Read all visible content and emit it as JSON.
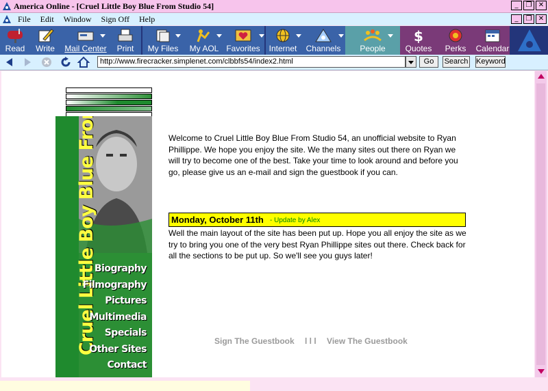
{
  "window": {
    "app_name": "America  Online",
    "title": "America  Online - [Cruel Little Boy Blue From Studio 54]"
  },
  "menu": [
    "File",
    "Edit",
    "Window",
    "Sign Off",
    "Help"
  ],
  "toolbar": {
    "buttons": [
      {
        "label": "Read",
        "icon": "mailbox-icon"
      },
      {
        "label": "Write",
        "icon": "pencil-icon"
      },
      {
        "label": "Mail Center",
        "icon": "mail-center-icon"
      },
      {
        "label": "Print",
        "icon": "printer-icon"
      },
      {
        "label": "My Files",
        "icon": "files-icon"
      },
      {
        "label": "My AOL",
        "icon": "my-aol-icon"
      },
      {
        "label": "Favorites",
        "icon": "heart-icon"
      },
      {
        "label": "Internet",
        "icon": "globe-icon"
      },
      {
        "label": "Channels",
        "icon": "channels-icon"
      },
      {
        "label": "People",
        "icon": "people-icon"
      },
      {
        "label": "Quotes",
        "icon": "dollar-icon"
      },
      {
        "label": "Perks",
        "icon": "perks-icon"
      },
      {
        "label": "Calendar",
        "icon": "calendar-icon"
      }
    ],
    "colors": {
      "blue": "#3a63a8",
      "teal": "#5aa0a8",
      "purple": "#7a3a78",
      "navy": "#23357a"
    }
  },
  "navigation": {
    "address": "http://www.firecracker.simplenet.com/clbbfs54/index2.html",
    "go_label": "Go",
    "search_label": "Search",
    "keyword_label": "Keyword"
  },
  "page": {
    "site_title": "Cruel Little Boy Blue From Studio 54",
    "nav": [
      "Biography",
      "Filmography",
      "Pictures",
      "Multimedia",
      "Specials",
      "Other Sites",
      "Contact"
    ],
    "welcome": "Welcome to Cruel Little Boy Blue From Studio 54, an unofficial website to Ryan Phillippe. We hope you enjoy the site. We the many sites out there on Ryan we will try to become one of the best. Take your time to look around and before you go, please give us an e-mail and sign the guestbook if you can.",
    "news": {
      "date": "Monday, October 11th",
      "by": " - Update by Alex",
      "body": "Well the main layout of the site has been put up. Hope you all enjoy the site as we try to bring you one of the very best Ryan Phillippe sites out there. Check back for all the sections to be put up. So we'll see you guys later!"
    },
    "guestbook": {
      "sign": "Sign The Guestbook",
      "sep": "l l l",
      "view": "View The Guestbook"
    }
  }
}
